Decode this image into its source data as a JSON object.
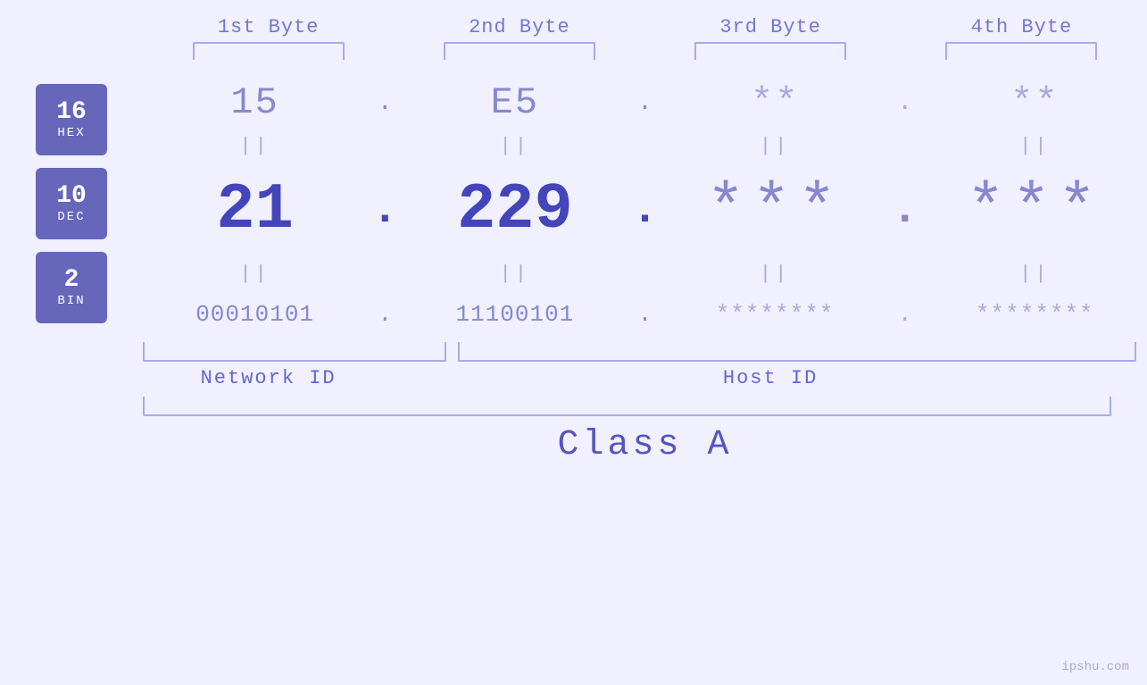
{
  "header": {
    "byte1": "1st Byte",
    "byte2": "2nd Byte",
    "byte3": "3rd Byte",
    "byte4": "4th Byte"
  },
  "badges": {
    "hex": {
      "number": "16",
      "label": "HEX"
    },
    "dec": {
      "number": "10",
      "label": "DEC"
    },
    "bin": {
      "number": "2",
      "label": "BIN"
    }
  },
  "hex_row": {
    "b1": "15",
    "b2": "E5",
    "b3": "**",
    "b4": "**",
    "dot": "."
  },
  "dec_row": {
    "b1": "21",
    "b2": "229",
    "b3": "***",
    "b4": "***",
    "dot": "."
  },
  "bin_row": {
    "b1": "00010101",
    "b2": "11100101",
    "b3": "********",
    "b4": "********",
    "dot": "."
  },
  "labels": {
    "network_id": "Network ID",
    "host_id": "Host ID",
    "class": "Class A"
  },
  "watermark": "ipshu.com"
}
